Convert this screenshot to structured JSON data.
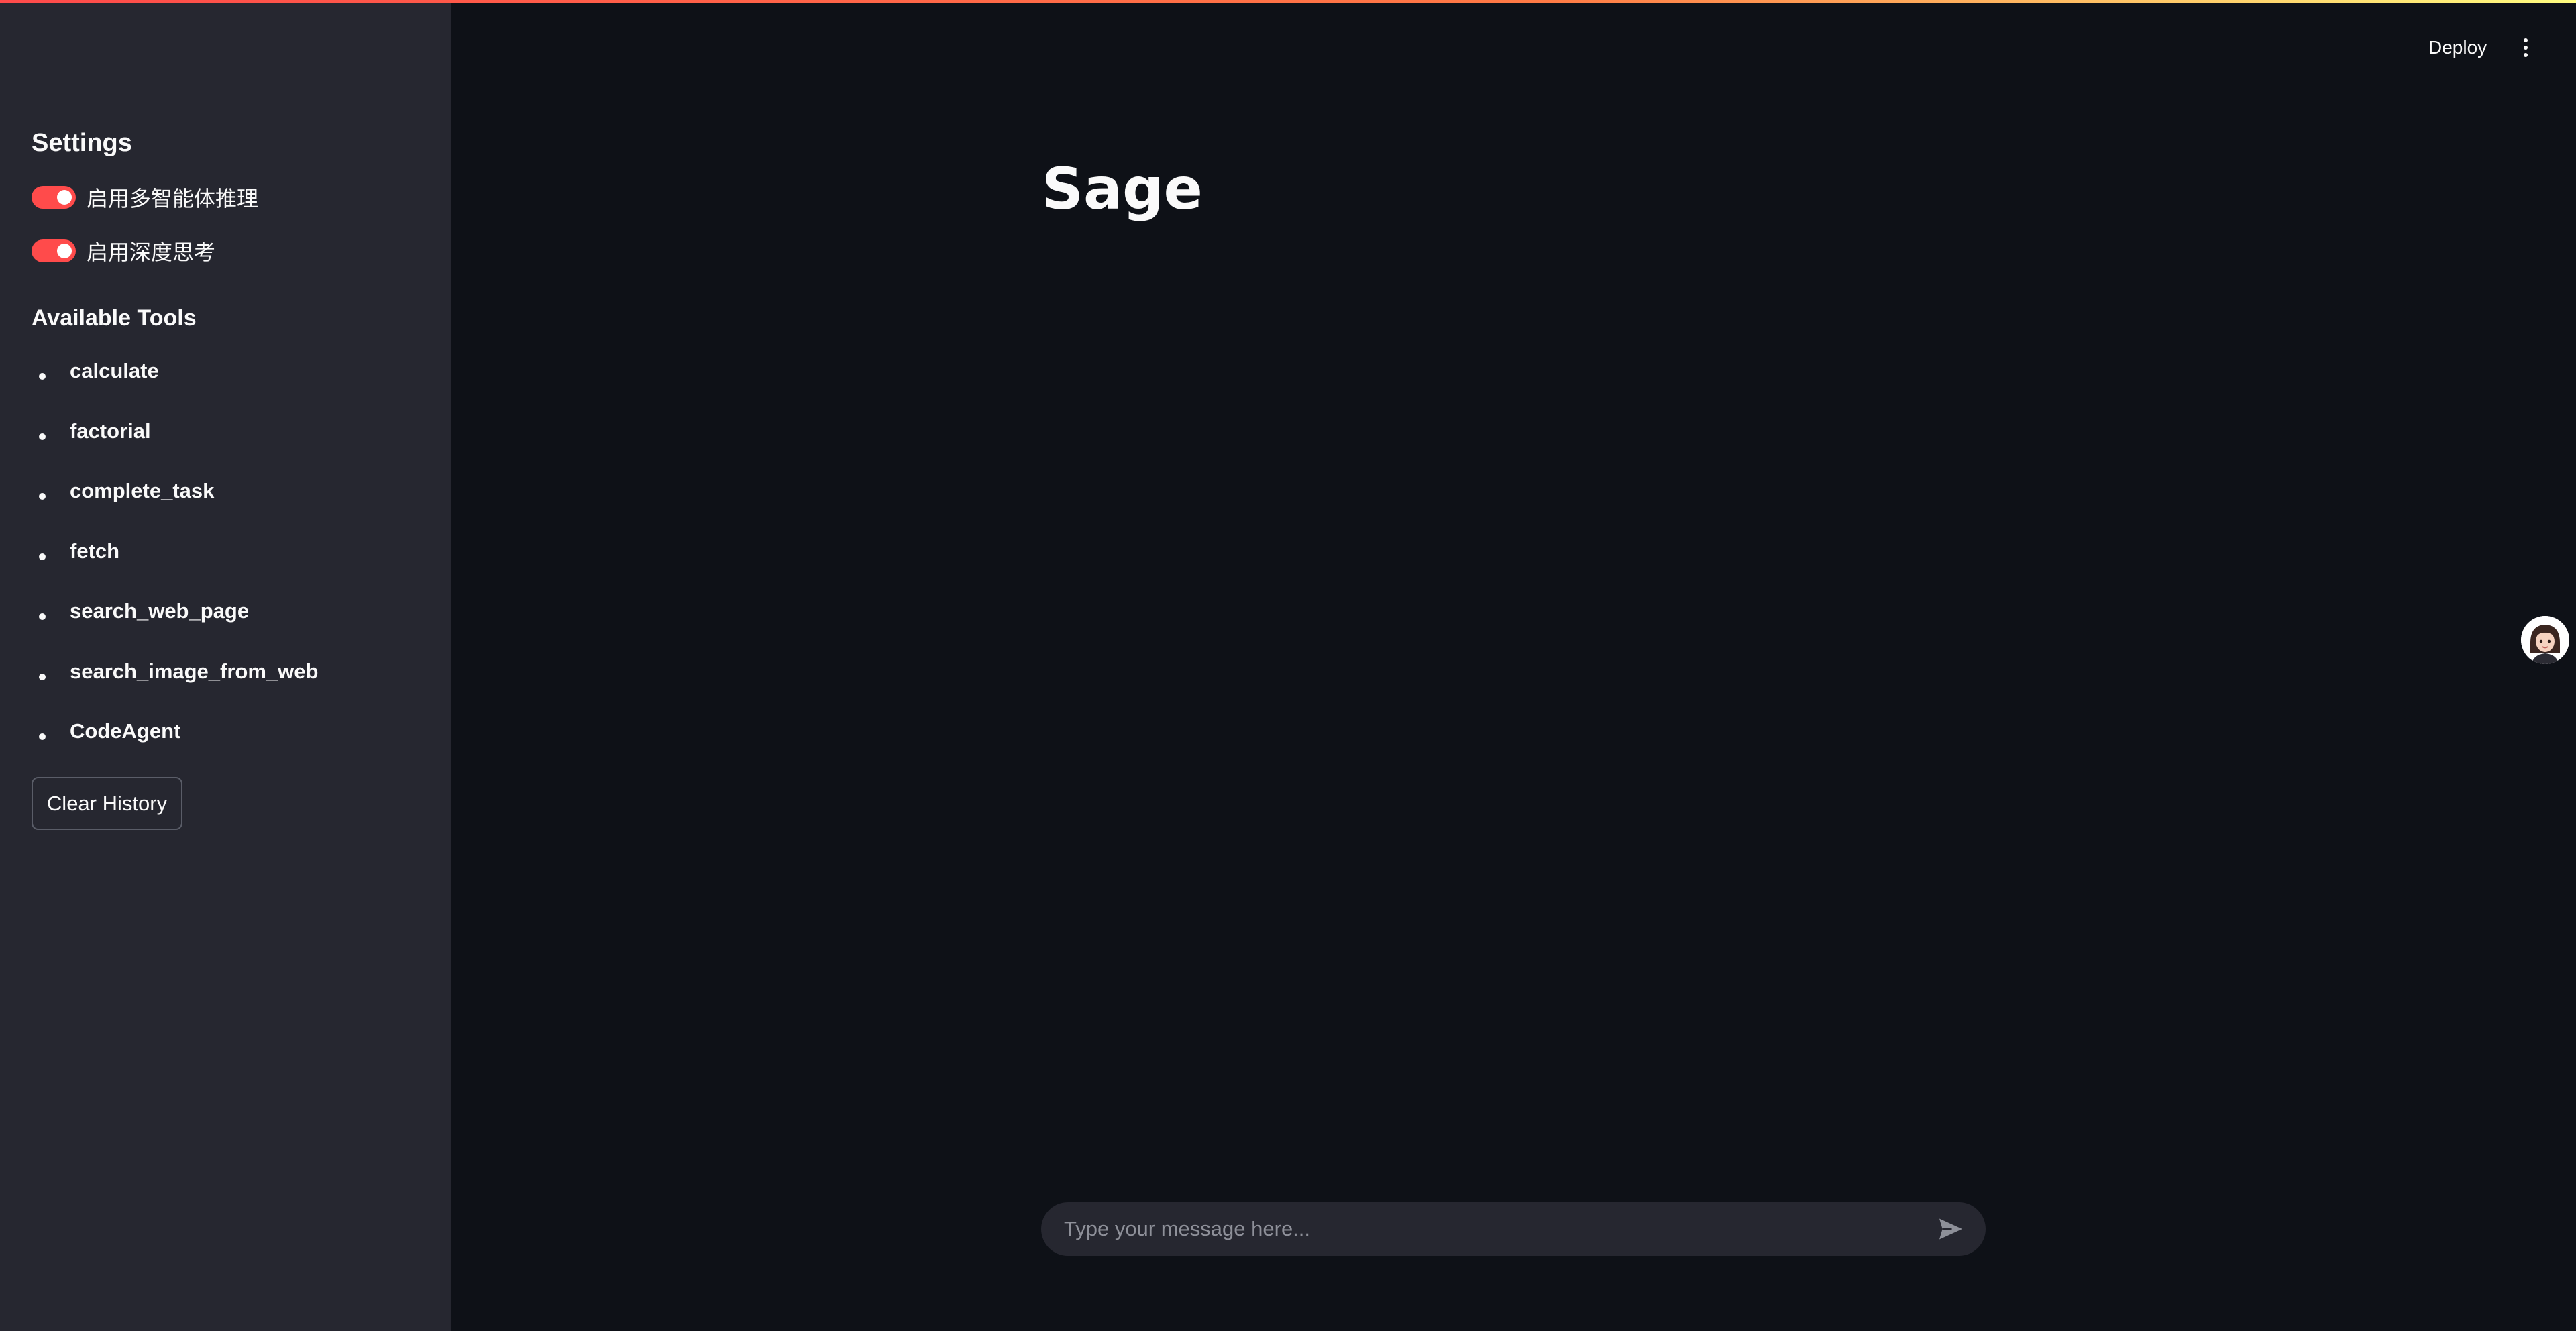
{
  "header": {
    "deploy_label": "Deploy",
    "menu_icon": "more-vertical-icon"
  },
  "sidebar": {
    "settings_heading": "Settings",
    "toggles": [
      {
        "label": "启用多智能体推理",
        "checked": true
      },
      {
        "label": "启用深度思考",
        "checked": true
      }
    ],
    "tools_heading": "Available Tools",
    "tools": [
      "calculate",
      "factorial",
      "complete_task",
      "fetch",
      "search_web_page",
      "search_image_from_web",
      "CodeAgent"
    ],
    "clear_history_label": "Clear History"
  },
  "main": {
    "title": "Sage",
    "avatar_icon": "user-avatar-icon"
  },
  "chat": {
    "placeholder": "Type your message here...",
    "value": "",
    "send_icon": "send-icon"
  },
  "colors": {
    "accent": "#ff4b4b",
    "sidebar_bg": "#262730",
    "main_bg": "#0e1117",
    "text": "#fafafa"
  }
}
